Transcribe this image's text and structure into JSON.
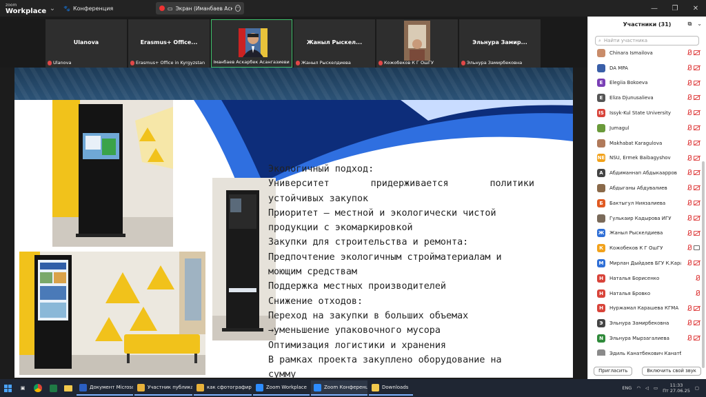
{
  "titlebar": {
    "brand_top": "zoom",
    "brand_bottom": "Workplace",
    "meeting_label": "Конференция",
    "share_label": "Экран (Иманбаев Аскарбек"
  },
  "videos": [
    {
      "name": "Ulanova",
      "label": "Ulanova"
    },
    {
      "name": "Erasmus+ Office...",
      "label": "Erasmus+ Office in Kyrgyzstan"
    },
    {
      "name": "",
      "label": "Иманбаев Аскарбек Асангазиевич"
    },
    {
      "name": "Жаныл Рыскел...",
      "label": "Жаныл Рыскелдиева"
    },
    {
      "name": "",
      "label": "Кожобеков К Г ОшГУ"
    },
    {
      "name": "Эльнура Замир...",
      "label": "Эльнура Замирбековна"
    }
  ],
  "slide": {
    "lines": [
      "  Экологичный подход:",
      [
        "Университет",
        "придерживается",
        "политики"
      ],
      "устойчивых закупок",
      "Приоритет – местной и экологически чистой",
      "продукции с экомаркировкой",
      "  Закупки для строительства и ремонта:",
      "Предпочтение экологичным стройматериалам и",
      "моющим средствам",
      "Поддержка местных производителей",
      "  Снижение отходов:",
      "Переход на закупки в больших объемах",
      "→уменьшение упаковочного мусора",
      "Оптимизация логистики и хранения",
      "В рамках проекта закуплено оборудование  на",
      "сумму"
    ]
  },
  "panel": {
    "title": "Участники (31)",
    "search_placeholder": "Найти участника",
    "participants": [
      {
        "name": "Chinara Ismailova",
        "initial": "",
        "color": "#c98c6a",
        "cam": "off"
      },
      {
        "name": "DA MPA",
        "initial": "",
        "color": "#3a5fa8",
        "cam": "off"
      },
      {
        "name": "Elegiia Bokoeva",
        "initial": "E",
        "color": "#7a3fb5",
        "cam": "off"
      },
      {
        "name": "Eliza Djunusalieva",
        "initial": "E",
        "color": "#555555",
        "cam": "off"
      },
      {
        "name": "Issyk-Kul State University",
        "initial": "IS",
        "color": "#d8443a",
        "cam": "off"
      },
      {
        "name": "Jumagul",
        "initial": "",
        "color": "#6a9a3a",
        "cam": "off"
      },
      {
        "name": "Makhabat Karagulova",
        "initial": "",
        "color": "#b07a5a",
        "cam": "off"
      },
      {
        "name": "NSU, Ermek Baibagyshov",
        "initial": "NE",
        "color": "#f2a21b",
        "cam": "off"
      },
      {
        "name": "Абдиманнап Абдыкаарров",
        "initial": "А",
        "color": "#444444",
        "cam": "off"
      },
      {
        "name": "Абдыганы Абдувалиев",
        "initial": "",
        "color": "#8a6a4a",
        "cam": "off"
      },
      {
        "name": "Бактыгул Ниязалиева",
        "initial": "Б",
        "color": "#e05a22",
        "cam": "off"
      },
      {
        "name": "Гулькаир Кадырова ИГУ",
        "initial": "",
        "color": "#7a6a5a",
        "cam": "off"
      },
      {
        "name": "Жаныл Рыскелдиева",
        "initial": "Ж",
        "color": "#2f6fd6",
        "cam": "off"
      },
      {
        "name": "Кожобеков К Г ОшГУ",
        "initial": "К",
        "color": "#f2a21b",
        "cam": "on"
      },
      {
        "name": "Мирлан Дыйдаев БГУ К.Карас...",
        "initial": "М",
        "color": "#2f6fd6",
        "cam": "off"
      },
      {
        "name": "Наталья Борисенко",
        "initial": "Н",
        "color": "#d8443a",
        "cam": "none"
      },
      {
        "name": "Наталья Бровко",
        "initial": "Н",
        "color": "#d8443a",
        "cam": "none"
      },
      {
        "name": "Нуржамал Карашева КГМА",
        "initial": "Н",
        "color": "#d8443a",
        "cam": "off"
      },
      {
        "name": "Эльнура Замирбековна",
        "initial": "Э",
        "color": "#444444",
        "cam": "off"
      },
      {
        "name": "Эльнура Мырзагалиева",
        "initial": "N",
        "color": "#2f8a3a",
        "cam": "off"
      },
      {
        "name": "Эдиль Канатбекович Канатбеков",
        "initial": "",
        "color": "#8a8a8a",
        "cam": "hidden"
      }
    ],
    "invite_label": "Пригласить",
    "unmute_label": "Включить свой звук"
  },
  "taskbar": {
    "apps": [
      {
        "label": "Документ Microsoft ...",
        "color": "#2b5fc2"
      },
      {
        "label": "Участник публикац...",
        "color": "#e8b23a"
      },
      {
        "label": "как сфотографиров...",
        "color": "#e8b23a"
      },
      {
        "label": "Zoom Workplace",
        "color": "#2d8cff"
      },
      {
        "label": "Zoom Конференция",
        "color": "#2d8cff"
      },
      {
        "label": "Downloads",
        "color": "#f2c94c"
      }
    ],
    "lang": "ENG",
    "time": "11:33",
    "date": "Пт 27.06.25"
  }
}
